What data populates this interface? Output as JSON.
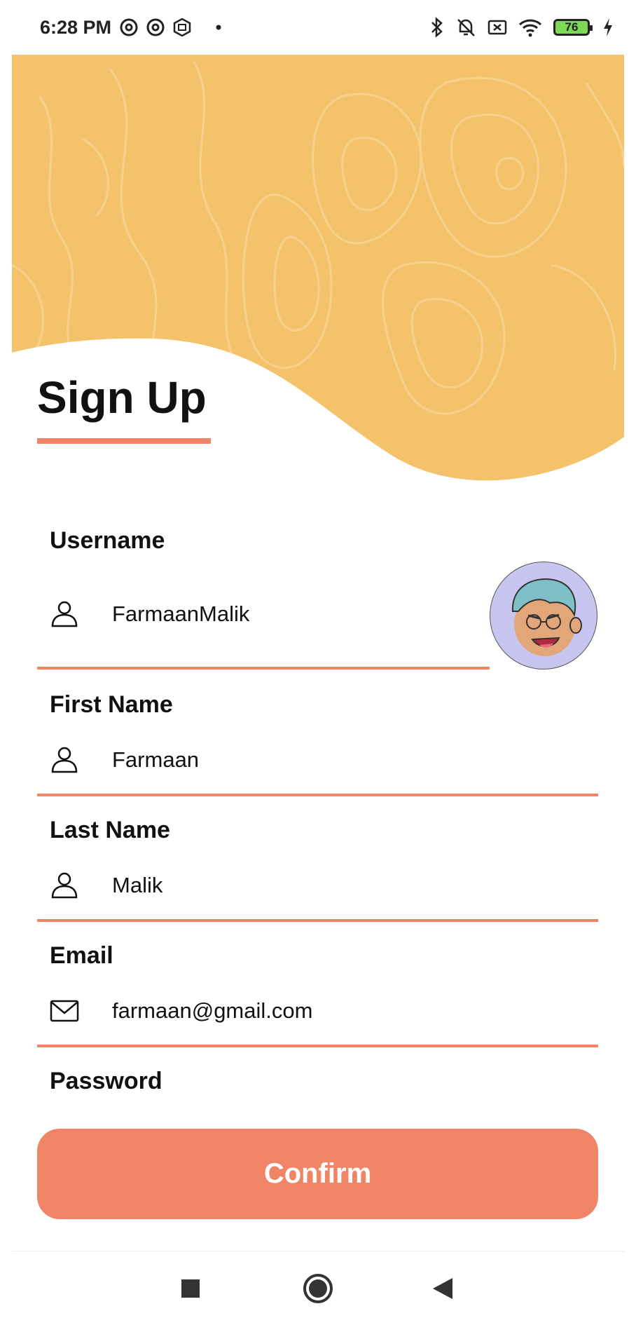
{
  "status_bar": {
    "time": "6:28 PM",
    "battery_level": "76",
    "left_icons": [
      "at-sign-icon",
      "at-sign-icon",
      "mi-icon",
      "dot-icon"
    ],
    "right_icons": [
      "bluetooth-icon",
      "bell-off-icon",
      "close-box-icon",
      "wifi-icon",
      "battery-icon",
      "charging-icon"
    ]
  },
  "page": {
    "title": "Sign Up",
    "accent_color": "#ef8466",
    "hero_color": "#f4c26b"
  },
  "form": {
    "username": {
      "label": "Username",
      "value": "FarmaanMalik",
      "icon": "person-icon"
    },
    "first_name": {
      "label": "First Name",
      "value": "Farmaan",
      "icon": "person-icon"
    },
    "last_name": {
      "label": "Last Name",
      "value": "Malik",
      "icon": "person-icon"
    },
    "email": {
      "label": "Email",
      "value": "farmaan@gmail.com",
      "icon": "mail-icon"
    },
    "password": {
      "label": "Password"
    }
  },
  "actions": {
    "confirm_label": "Confirm"
  },
  "nav": {
    "buttons": [
      "recents-square-icon",
      "home-circle-icon",
      "back-triangle-icon"
    ]
  }
}
